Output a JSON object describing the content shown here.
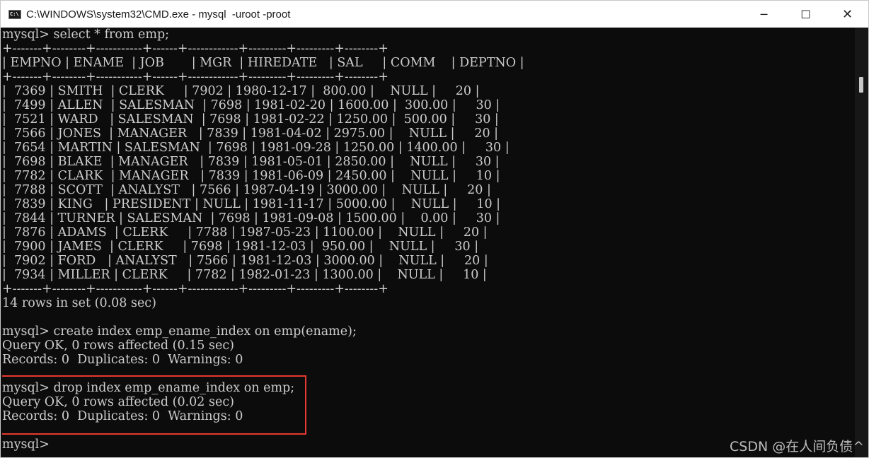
{
  "window": {
    "title": "C:\\WINDOWS\\system32\\CMD.exe - mysql  -uroot -proot",
    "icon_label": "C:\\",
    "controls": {
      "minimize": "─",
      "maximize": "☐",
      "close": "✕"
    }
  },
  "console": {
    "lines": [
      "mysql> select * from emp;",
      "+-------+--------+-----------+------+------------+---------+---------+--------+",
      "| EMPNO | ENAME  | JOB       | MGR  | HIREDATE   | SAL     | COMM    | DEPTNO |",
      "+-------+--------+-----------+------+------------+---------+---------+--------+",
      "|  7369 | SMITH  | CLERK     | 7902 | 1980-12-17 |  800.00 |    NULL |     20 |",
      "|  7499 | ALLEN  | SALESMAN  | 7698 | 1981-02-20 | 1600.00 |  300.00 |     30 |",
      "|  7521 | WARD   | SALESMAN  | 7698 | 1981-02-22 | 1250.00 |  500.00 |     30 |",
      "|  7566 | JONES  | MANAGER   | 7839 | 1981-04-02 | 2975.00 |    NULL |     20 |",
      "|  7654 | MARTIN | SALESMAN  | 7698 | 1981-09-28 | 1250.00 | 1400.00 |     30 |",
      "|  7698 | BLAKE  | MANAGER   | 7839 | 1981-05-01 | 2850.00 |    NULL |     30 |",
      "|  7782 | CLARK  | MANAGER   | 7839 | 1981-06-09 | 2450.00 |    NULL |     10 |",
      "|  7788 | SCOTT  | ANALYST   | 7566 | 1987-04-19 | 3000.00 |    NULL |     20 |",
      "|  7839 | KING   | PRESIDENT | NULL | 1981-11-17 | 5000.00 |    NULL |     10 |",
      "|  7844 | TURNER | SALESMAN  | 7698 | 1981-09-08 | 1500.00 |    0.00 |     30 |",
      "|  7876 | ADAMS  | CLERK     | 7788 | 1987-05-23 | 1100.00 |    NULL |     20 |",
      "|  7900 | JAMES  | CLERK     | 7698 | 1981-12-03 |  950.00 |    NULL |     30 |",
      "|  7902 | FORD   | ANALYST   | 7566 | 1981-12-03 | 3000.00 |    NULL |     20 |",
      "|  7934 | MILLER | CLERK     | 7782 | 1982-01-23 | 1300.00 |    NULL |     10 |",
      "+-------+--------+-----------+------+------------+---------+---------+--------+",
      "14 rows in set (0.08 sec)",
      "",
      "mysql> create index emp_ename_index on emp(ename);",
      "Query OK, 0 rows affected (0.15 sec)",
      "Records: 0  Duplicates: 0  Warnings: 0",
      "",
      "mysql> drop index emp_ename_index on emp;",
      "Query OK, 0 rows affected (0.02 sec)",
      "Records: 0  Duplicates: 0  Warnings: 0",
      "",
      "mysql>"
    ]
  },
  "watermark": "CSDN @在人间负债^",
  "colors": {
    "console_bg": "#0c0c0c",
    "console_text": "#cccccc",
    "titlebar_bg": "#ffffff",
    "highlight_border": "#e6392f"
  }
}
